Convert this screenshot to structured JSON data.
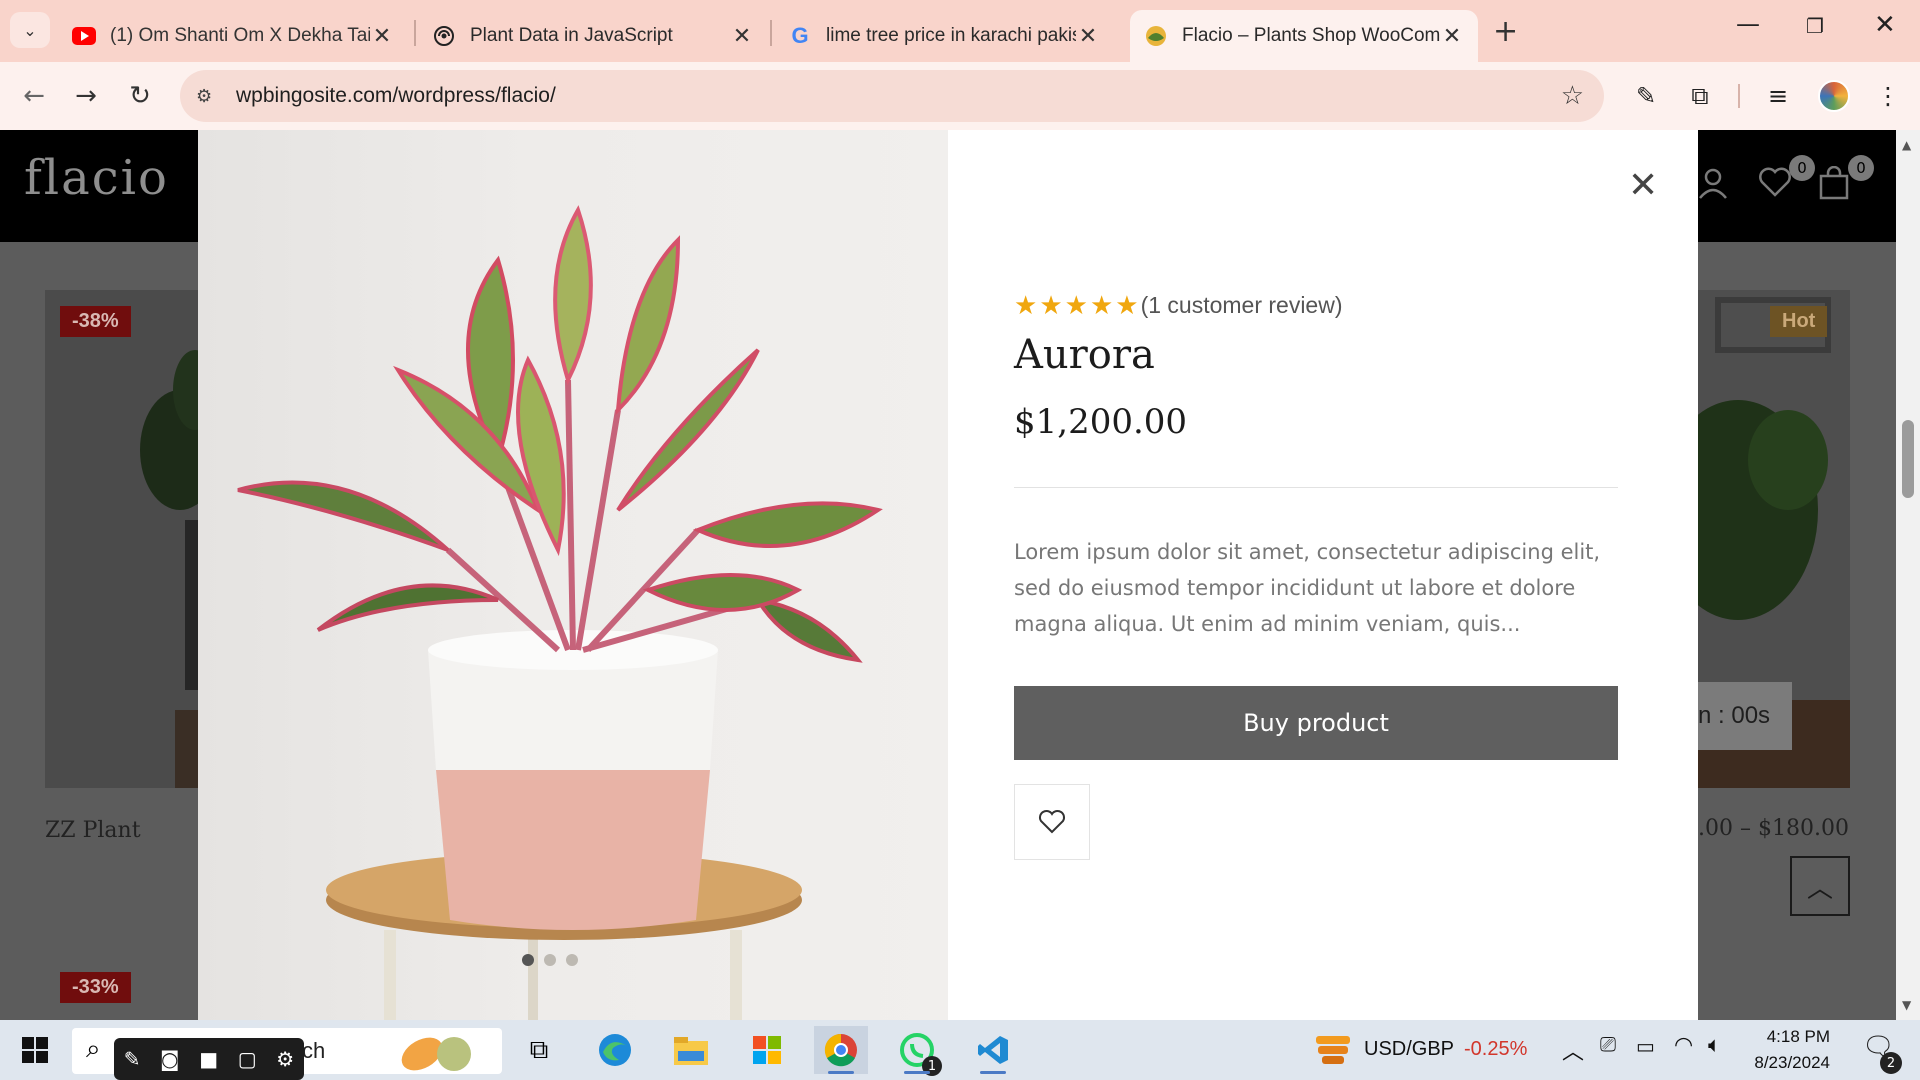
{
  "browser": {
    "tabs": [
      {
        "title": "(1) Om Shanti Om X Dekha Tain",
        "favicon": "youtube-icon"
      },
      {
        "title": "Plant Data in JavaScript",
        "favicon": "chatgpt-icon"
      },
      {
        "title": "lime tree price in karachi pakist",
        "favicon": "google-icon"
      },
      {
        "title": "Flacio – Plants Shop WooComm",
        "favicon": "flacio-icon",
        "active": true
      }
    ],
    "url": "wpbingosite.com/wordpress/flacio/"
  },
  "site": {
    "logo": "flacio",
    "wishlist_count": "0",
    "cart_count": "0",
    "cards": [
      {
        "badge": "-38%",
        "name": "ZZ Plant"
      },
      {
        "badge": "Hot",
        "price": ".00 – $180.00",
        "countdown": "n : 00s"
      },
      {
        "badge": "-33%"
      }
    ]
  },
  "modal": {
    "rating_stars": 5,
    "review_text": "(1 customer review)",
    "product_title": "Aurora",
    "price": "$1,200.00",
    "description": "Lorem ipsum dolor sit amet, consectetur adipiscing elit, sed do eiusmod tempor incididunt ut labore et dolore magna aliqua. Ut enim ad minim veniam, quis...",
    "buy_label": "Buy product"
  },
  "taskbar": {
    "search_text": "ch",
    "ticker_label": "USD/GBP",
    "ticker_change": "-0.25%",
    "time": "4:18 PM",
    "date": "8/23/2024",
    "whatsapp_badge": "1",
    "notification_count": "2"
  },
  "colors": {
    "accent_star": "#f0a70f",
    "sale_badge": "#700d0d",
    "ticker_negative": "#d2362b"
  }
}
